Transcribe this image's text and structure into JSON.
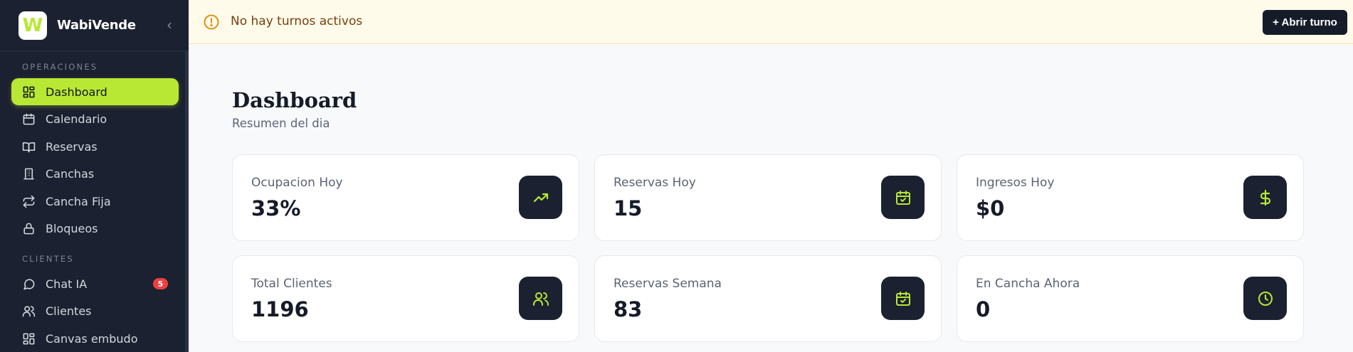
{
  "app": {
    "name": "WabiVende",
    "logo_letter": "W"
  },
  "sidebar": {
    "section_operations": "OPERACIONES",
    "section_clients": "CLIENTES",
    "items": [
      {
        "label": "Dashboard",
        "icon": "dashboard-icon",
        "active": true
      },
      {
        "label": "Calendario",
        "icon": "calendar-icon"
      },
      {
        "label": "Reservas",
        "icon": "book-icon"
      },
      {
        "label": "Canchas",
        "icon": "building-icon"
      },
      {
        "label": "Cancha Fija",
        "icon": "repeat-icon"
      },
      {
        "label": "Bloqueos",
        "icon": "lock-icon"
      },
      {
        "label": "Chat IA",
        "icon": "chat-icon",
        "badge": "5"
      },
      {
        "label": "Clientes",
        "icon": "users-icon"
      },
      {
        "label": "Canvas embudo",
        "icon": "grid-icon"
      }
    ]
  },
  "banner": {
    "text": "No hay turnos activos",
    "button": "+ Abrir turno"
  },
  "page": {
    "title": "Dashboard",
    "subtitle": "Resumen del dia"
  },
  "cards": [
    {
      "label": "Ocupacion Hoy",
      "value": "33%",
      "icon": "trending-up-icon"
    },
    {
      "label": "Reservas Hoy",
      "value": "15",
      "icon": "calendar-check-icon"
    },
    {
      "label": "Ingresos Hoy",
      "value": "$0",
      "icon": "dollar-icon"
    },
    {
      "label": "Total Clientes",
      "value": "1196",
      "icon": "users-icon"
    },
    {
      "label": "Reservas Semana",
      "value": "83",
      "icon": "calendar-check-icon"
    },
    {
      "label": "En Cancha Ahora",
      "value": "0",
      "icon": "clock-icon"
    }
  ],
  "colors": {
    "accent": "#b9e834",
    "sidebar_bg": "#1b2130",
    "banner_bg": "#fffbea",
    "banner_text": "#7a3e0f",
    "badge": "#ef3f3f"
  }
}
